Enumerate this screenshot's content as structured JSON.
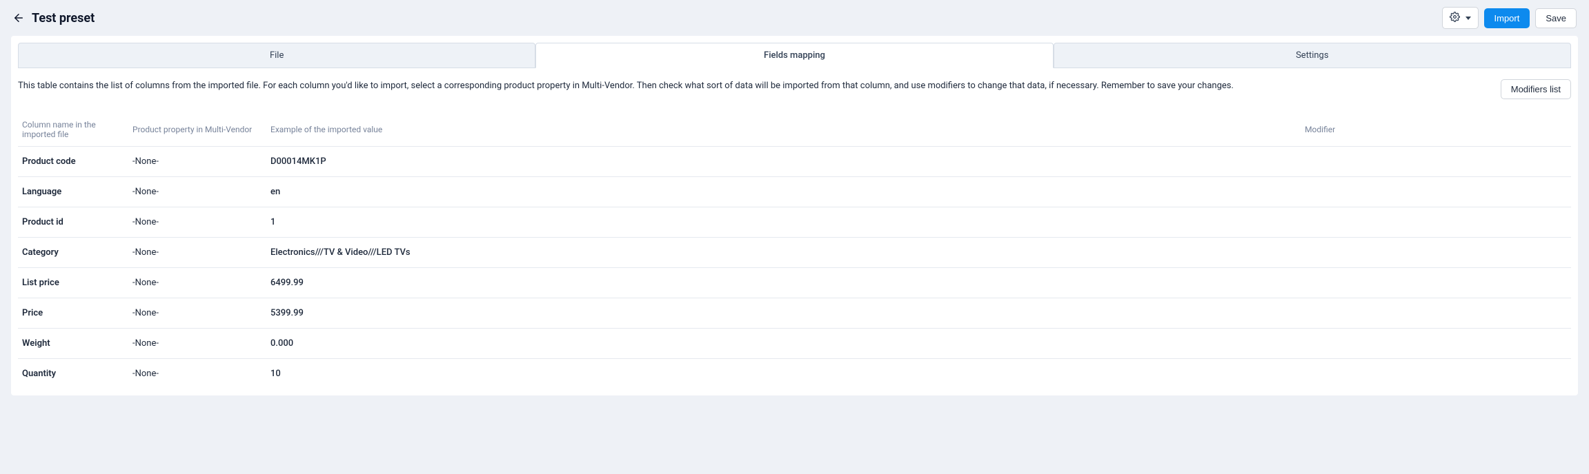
{
  "header": {
    "title": "Test preset",
    "import_label": "Import",
    "save_label": "Save"
  },
  "tabs": {
    "file": "File",
    "fields_mapping": "Fields mapping",
    "settings": "Settings"
  },
  "info_text": "This table contains the list of columns from the imported file. For each column you'd like to import, select a corresponding product property in Multi-Vendor. Then check what sort of data will be imported from that column, and use modifiers to change that data, if necessary. Remember to save your changes.",
  "modifiers_btn": "Modifiers list",
  "table": {
    "headers": {
      "col_name": "Column name in the imported file",
      "col_prop": "Product property in Multi-Vendor",
      "col_example": "Example of the imported value",
      "col_modifier": "Modifier"
    },
    "rows": [
      {
        "name": "Product code",
        "prop": "-None-",
        "example": "D00014MK1P"
      },
      {
        "name": "Language",
        "prop": "-None-",
        "example": "en"
      },
      {
        "name": "Product id",
        "prop": "-None-",
        "example": "1"
      },
      {
        "name": "Category",
        "prop": "-None-",
        "example": "Electronics///TV & Video///LED TVs"
      },
      {
        "name": "List price",
        "prop": "-None-",
        "example": "6499.99"
      },
      {
        "name": "Price",
        "prop": "-None-",
        "example": "5399.99"
      },
      {
        "name": "Weight",
        "prop": "-None-",
        "example": "0.000"
      },
      {
        "name": "Quantity",
        "prop": "-None-",
        "example": "10"
      }
    ]
  }
}
